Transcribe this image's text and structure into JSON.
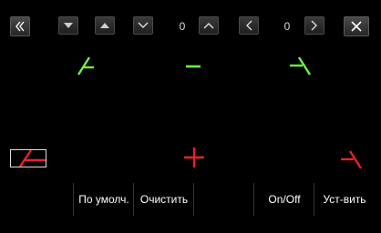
{
  "toolbar": {
    "collapse_icon": "double-chevron-left-icon",
    "counter_a": "0",
    "counter_b": "0",
    "close_icon": "close-x-icon"
  },
  "bottom_bar": {
    "default_label": "По умолч.",
    "clear_label": "Очистить",
    "onoff_label": "On/Off",
    "set_label": "Уст-вить"
  },
  "colors": {
    "active": "#6df24a",
    "inactive": "#e8202a"
  },
  "markers": [
    {
      "name": "top-left",
      "state": "active"
    },
    {
      "name": "top-center",
      "state": "active"
    },
    {
      "name": "top-right",
      "state": "active"
    },
    {
      "name": "bottom-center",
      "state": "inactive"
    },
    {
      "name": "bottom-right",
      "state": "inactive"
    },
    {
      "name": "bottom-left",
      "state": "inactive"
    }
  ]
}
